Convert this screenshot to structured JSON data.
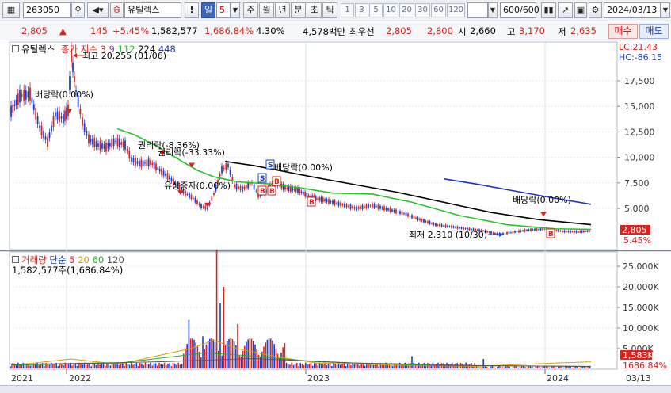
{
  "toolbar": {
    "code": "263050",
    "name_prefix": "증",
    "stock_name": "유틸렉스",
    "period_selected": "일",
    "period_count": "5",
    "periods": [
      "주",
      "월",
      "년",
      "분",
      "초",
      "틱"
    ],
    "intervals": [
      "1",
      "3",
      "5",
      "10",
      "20",
      "30",
      "60",
      "120"
    ],
    "data_count": "600",
    "data_count_max": "/600",
    "date": "2024/03/13"
  },
  "quote": {
    "price": "2,805",
    "change_arrow": "▲",
    "change": "145",
    "change_pct": "+5.45%",
    "volume": "1,582,577",
    "volume_ratio": "1,686.84%",
    "turnover": "4.30%",
    "amount": "4,578백만",
    "best_bid_label": "최우선",
    "best_ask": "2,805",
    "best_bid": "2,800",
    "open_label": "시",
    "open": "2,660",
    "high_label": "고",
    "high": "3,170",
    "low_label": "저",
    "low": "2,635",
    "buy_label": "매수",
    "sell_label": "매도"
  },
  "price_panel": {
    "stock_label": "유틸렉스",
    "ma_label": "종가 지수",
    "ma_periods": [
      "3",
      "9",
      "112",
      "224",
      "448"
    ],
    "lc": "LC:21.43",
    "hc": "HC:-86.15",
    "y_ticks": [
      "17,500",
      "15,000",
      "12,500",
      "10,000",
      "7,500",
      "5,000"
    ],
    "current_price_tag": "2,805",
    "current_pct_tag": "5.45%",
    "max_label": "최고 20,255 (01/06)",
    "min_label": "최저 2,310 (10/30)",
    "annotations": [
      "배당락(0.00%)",
      "권리락(-8.36%)",
      "권리락(-33.33%)",
      "유상증자(0.00%)",
      "배당락(0.00%)",
      "배당락(0.00%)"
    ],
    "marker_b": "B",
    "marker_s": "S"
  },
  "volume_panel": {
    "title": "거래량",
    "ma_label": "단순",
    "ma_periods": [
      "5",
      "20",
      "60",
      "120"
    ],
    "current_volume": "1,582,577주(1,686.84%)",
    "y_ticks": [
      "25,000K",
      "20,000K",
      "15,000K",
      "10,000K",
      "5,000K"
    ],
    "current_volume_tag": "1,583K",
    "current_ratio_tag": "1686.84%"
  },
  "x_axis": {
    "labels": [
      "2021",
      "2022",
      "2023",
      "2024"
    ],
    "last_date": "03/13"
  },
  "colors": {
    "candle_up": "#e0201a",
    "candle_down": "#1a3fd0",
    "ma112": "#27c427",
    "ma224": "#000000",
    "ma448": "#1d2fcc",
    "ma3": "#c0392b",
    "ma9": "#8e44ad"
  }
}
